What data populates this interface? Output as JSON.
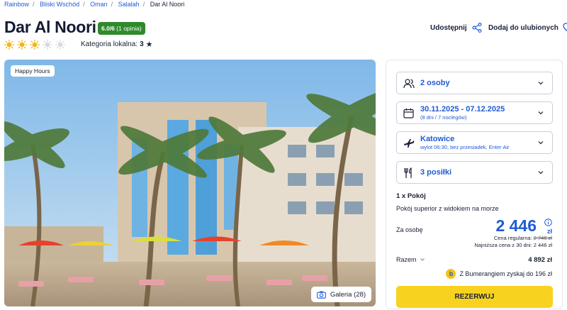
{
  "breadcrumb": {
    "items": [
      "Rainbow",
      "Bliski Wschód",
      "Oman",
      "Salalah"
    ],
    "current": "Dar Al Noori"
  },
  "hotel": {
    "name": "Dar Al Noori",
    "rating": "6.0/6",
    "rating_reviews": "(1 opinia)",
    "sun_rating": {
      "filled": 3,
      "total": 5
    },
    "local_category_label": "Kategoria lokalna:",
    "local_category_value": "3"
  },
  "actions": {
    "share": "Udostępnij",
    "favorite": "Dodaj do ulubionych"
  },
  "gallery": {
    "tag": "Happy Hours",
    "button": "Galeria (28)"
  },
  "booking": {
    "persons": "2 osoby",
    "dates": "30.11.2025 - 07.12.2025",
    "dates_sub": "(8 dni / 7 noclegów)",
    "departure": "Katowice",
    "departure_sub": "wylot 06:30, bez przesiadek, Enter Air",
    "meals": "3 posiłki",
    "room_count": "1 x Pokój",
    "room_name": "Pokój superior z widokiem na morze",
    "per_person_label": "Za osobę",
    "price": "2 446",
    "currency": "zł",
    "regular_label": "Cena regularna:",
    "regular_price": "2 746 zł",
    "lowest_30": "Najniższa cena z 30 dni: 2 446 zł",
    "total_label": "Razem",
    "total_value": "4 892 zł",
    "bumerang": "Z Bumerangiem zyskaj do 196 zł",
    "bumerang_coin": "b",
    "book_button": "REZERWUJ"
  },
  "colors": {
    "link": "#1f5bd6",
    "rating_badge": "#2f8a2c",
    "sun": "#f2b61c",
    "sun_empty": "#d7dae2",
    "book_button": "#f7d21f"
  },
  "icons": [
    "sun-icon",
    "star-icon",
    "share-icon",
    "heart-icon",
    "users-icon",
    "calendar-icon",
    "plane-icon",
    "cutlery-icon",
    "chevron-down-icon",
    "info-icon",
    "camera-icon"
  ]
}
